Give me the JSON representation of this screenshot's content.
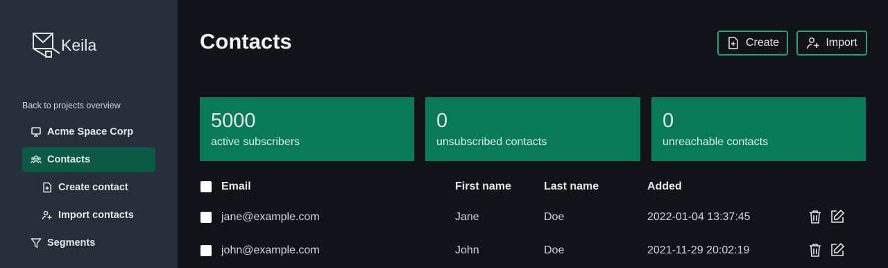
{
  "app": {
    "name": "Keila"
  },
  "sidebar": {
    "back_label": "Back to projects overview",
    "project_label": "Acme Space Corp",
    "items": [
      {
        "label": "Contacts",
        "icon": "users-icon",
        "active": true
      },
      {
        "label": "Create contact",
        "icon": "file-plus-icon"
      },
      {
        "label": "Import contacts",
        "icon": "user-plus-icon"
      },
      {
        "label": "Segments",
        "icon": "filter-icon"
      }
    ]
  },
  "header": {
    "title": "Contacts",
    "create_label": "Create",
    "import_label": "Import"
  },
  "stats": [
    {
      "value": "5000",
      "label": "active subscribers"
    },
    {
      "value": "0",
      "label": "unsubscribed contacts"
    },
    {
      "value": "0",
      "label": "unreachable contacts"
    }
  ],
  "table": {
    "columns": [
      "Email",
      "First name",
      "Last name",
      "Added"
    ],
    "rows": [
      {
        "email": "jane@example.com",
        "first_name": "Jane",
        "last_name": "Doe",
        "added": "2022-01-04 13:37:45"
      },
      {
        "email": "john@example.com",
        "first_name": "John",
        "last_name": "Doe",
        "added": "2021-11-29 20:02:19"
      }
    ]
  },
  "colors": {
    "sidebar_bg": "#262e3a",
    "main_bg": "#111318",
    "accent": "#087a57",
    "active_nav": "#0c5a44",
    "button_border": "#23a07a"
  }
}
